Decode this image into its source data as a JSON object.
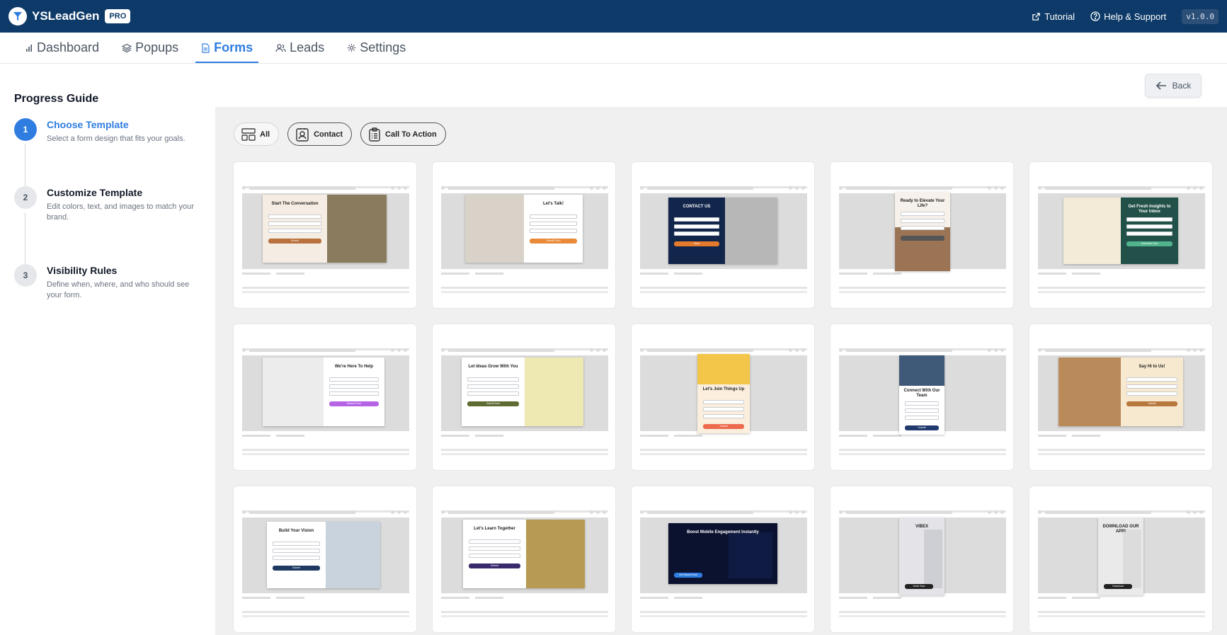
{
  "app": {
    "name": "YSLeadGen",
    "badge": "PRO",
    "version": "v1.0.0"
  },
  "topbar": {
    "tutorial": "Tutorial",
    "help": "Help & Support"
  },
  "nav": {
    "tabs": [
      {
        "label": "Dashboard",
        "icon": "bar-chart-icon"
      },
      {
        "label": "Popups",
        "icon": "layers-icon"
      },
      {
        "label": "Forms",
        "icon": "document-icon",
        "active": true
      },
      {
        "label": "Leads",
        "icon": "users-icon"
      },
      {
        "label": "Settings",
        "icon": "gear-icon"
      }
    ]
  },
  "sidebar": {
    "title": "Progress Guide",
    "steps": [
      {
        "num": "1",
        "title": "Choose Template",
        "desc": "Select a form design that fits your goals.",
        "active": true
      },
      {
        "num": "2",
        "title": "Customize Template",
        "desc": "Edit colors, text, and images to match your brand."
      },
      {
        "num": "3",
        "title": "Visibility Rules",
        "desc": "Define when, where, and who should see your form."
      }
    ]
  },
  "back_label": "Back",
  "filters": [
    {
      "label": "All",
      "icon": "layout-icon",
      "active": true
    },
    {
      "label": "Contact",
      "icon": "contact-icon"
    },
    {
      "label": "Call To Action",
      "icon": "clipboard-icon"
    }
  ],
  "colors": {
    "primary": "#2f7de1",
    "topbar": "#0d3a68"
  },
  "templates": [
    {
      "heading": "Start The Conversation",
      "button": "Submit",
      "bg": "#f5ede3",
      "btn": "#b9713d",
      "img": "#8a7a5e"
    },
    {
      "heading": "Let's Talk!",
      "button": "Submit Form",
      "bg": "#ffffff",
      "btn": "#e98a3a",
      "img": "#d8d2c8"
    },
    {
      "heading": "CONTACT US",
      "button": "Send",
      "bg": "#12254a",
      "btn": "#e57a2d",
      "img": "#b7b7b7"
    },
    {
      "heading": "Ready to Elevate Your Life?",
      "button": "",
      "bg": "#f6f1ea",
      "btn": "#555555",
      "img": "#9b7355"
    },
    {
      "heading": "Get Fresh Insights to Your Inbox",
      "button": "Subscribe Now",
      "bg": "#22514a",
      "btn": "#52b48e",
      "img": "#f3ead7"
    },
    {
      "heading": "We're Here To Help",
      "button": "Submit Form",
      "bg": "#ffffff",
      "btn": "#b664e6",
      "img": "#ececec"
    },
    {
      "heading": "Let Ideas Grow With You",
      "button": "Submit Now",
      "bg": "#ffffff",
      "btn": "#5e6b33",
      "img": "#eee8b3"
    },
    {
      "heading": "Let's Join Things Up",
      "button": "Submit",
      "bg": "#fbeedd",
      "btn": "#ed6a4e",
      "img": "#f3c64a"
    },
    {
      "heading": "Connect With Our Team",
      "button": "Submit",
      "bg": "#ffffff",
      "btn": "#213a6e",
      "img": "#3f5a78"
    },
    {
      "heading": "Say Hi to Us!",
      "button": "Submit",
      "bg": "#f7e9cf",
      "btn": "#b8783d",
      "img": "#b98a5a"
    },
    {
      "heading": "Build Your Vision",
      "button": "Submit",
      "bg": "#ffffff",
      "btn": "#1f3a62",
      "img": "#c9d3dd"
    },
    {
      "heading": "Let's Learn Together",
      "button": "Submit",
      "bg": "#ffffff",
      "btn": "#3a2a6b",
      "img": "#b79a54"
    },
    {
      "heading": "Boost Mobile Engagement Instantly",
      "button": "Get Started Now",
      "bg": "#0b1230",
      "btn": "#2f7de1",
      "img": "#13204d"
    },
    {
      "heading": "VIBEX",
      "button": "Order Now",
      "bg": "#e4e4e8",
      "btn": "#222222",
      "img": "#c4c6cc"
    },
    {
      "heading": "DOWNLOAD OUR APP!",
      "button": "Download",
      "bg": "#eaeaea",
      "btn": "#222222",
      "img": "#d6d6d6"
    }
  ]
}
